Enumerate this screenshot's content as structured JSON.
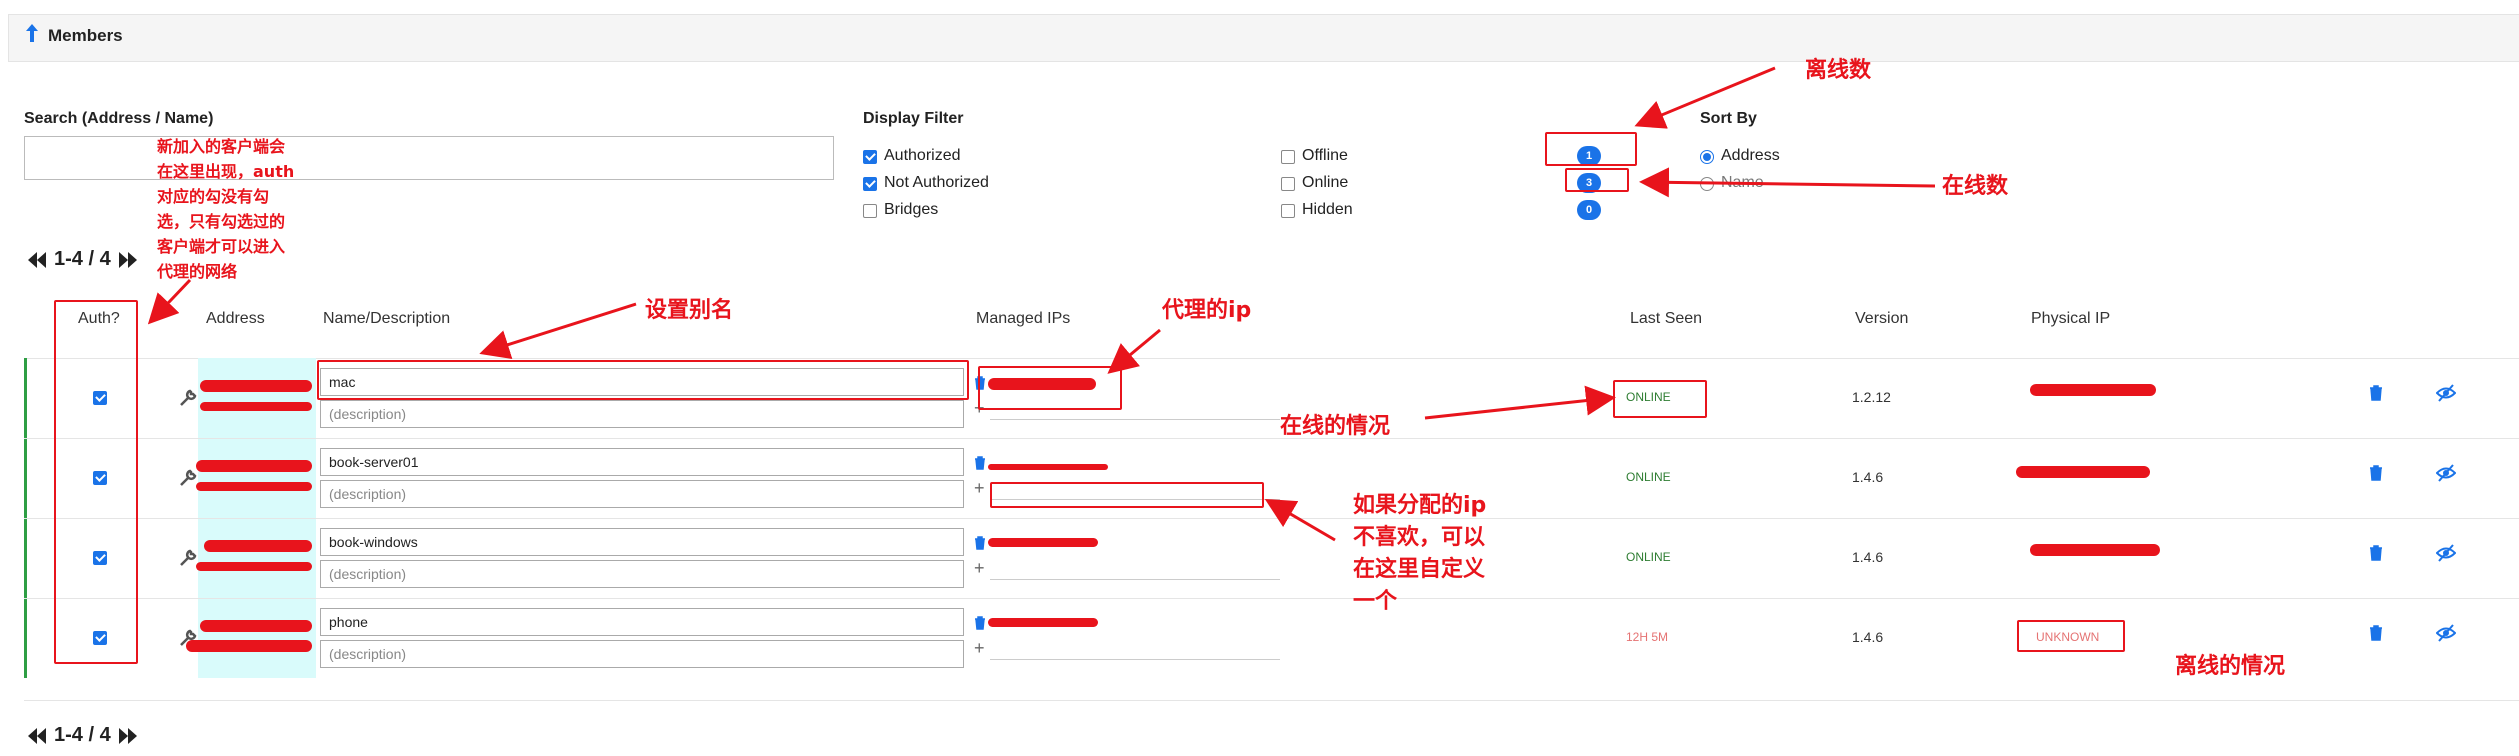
{
  "header": {
    "title": "Members"
  },
  "search": {
    "label": "Search (Address / Name)",
    "value": "",
    "placeholder": ""
  },
  "display_filter": {
    "label": "Display Filter",
    "options": [
      {
        "label": "Authorized",
        "checked": true
      },
      {
        "label": "Not Authorized",
        "checked": true
      },
      {
        "label": "Bridges",
        "checked": false
      },
      {
        "label": "Offline",
        "checked": false,
        "count": "1"
      },
      {
        "label": "Online",
        "checked": false,
        "count": "3"
      },
      {
        "label": "Hidden",
        "checked": false,
        "count": "0"
      }
    ]
  },
  "sort_by": {
    "label": "Sort By",
    "options": [
      {
        "label": "Address",
        "selected": true
      },
      {
        "label": "Name",
        "selected": false
      }
    ]
  },
  "pager": {
    "range": "1-4 / 4"
  },
  "table": {
    "columns": {
      "auth": "Auth?",
      "address": "Address",
      "name": "Name/Description",
      "ips": "Managed IPs",
      "last_seen": "Last Seen",
      "version": "Version",
      "physical_ip": "Physical IP"
    },
    "rows": [
      {
        "authorized": true,
        "name": "mac",
        "description_placeholder": "(description)",
        "last_seen": "ONLINE",
        "version": "1.2.12"
      },
      {
        "authorized": true,
        "name": "book-server01",
        "description_placeholder": "(description)",
        "last_seen": "ONLINE",
        "version": "1.4.6"
      },
      {
        "authorized": true,
        "name": "book-windows",
        "description_placeholder": "(description)",
        "last_seen": "ONLINE",
        "version": "1.4.6"
      },
      {
        "authorized": true,
        "name": "phone",
        "description_placeholder": "(description)",
        "last_seen": "12H 5M",
        "version": "1.4.6",
        "physical_ip": "UNKNOWN"
      }
    ]
  },
  "annotations": {
    "new_client": [
      "新加入的客户端会",
      "在这里出现，auth",
      "对应的勾没有勾",
      "选，只有勾选过的",
      "客户端才可以进入",
      "代理的网络"
    ],
    "offline_count": "离线数",
    "online_count": "在线数",
    "set_alias": "设置别名",
    "proxy_ip": "代理的ip",
    "online_status": "在线的情况",
    "custom_ip": [
      "如果分配的ip",
      "不喜欢，可以",
      "在这里自定义",
      "一个"
    ],
    "offline_status": "离线的情况"
  },
  "colors": {
    "accent": "#1a73e8",
    "online": "#2e7d32",
    "offline": "#e57373",
    "annotation": "#e8141c",
    "status_bar": "#2e9e44"
  }
}
